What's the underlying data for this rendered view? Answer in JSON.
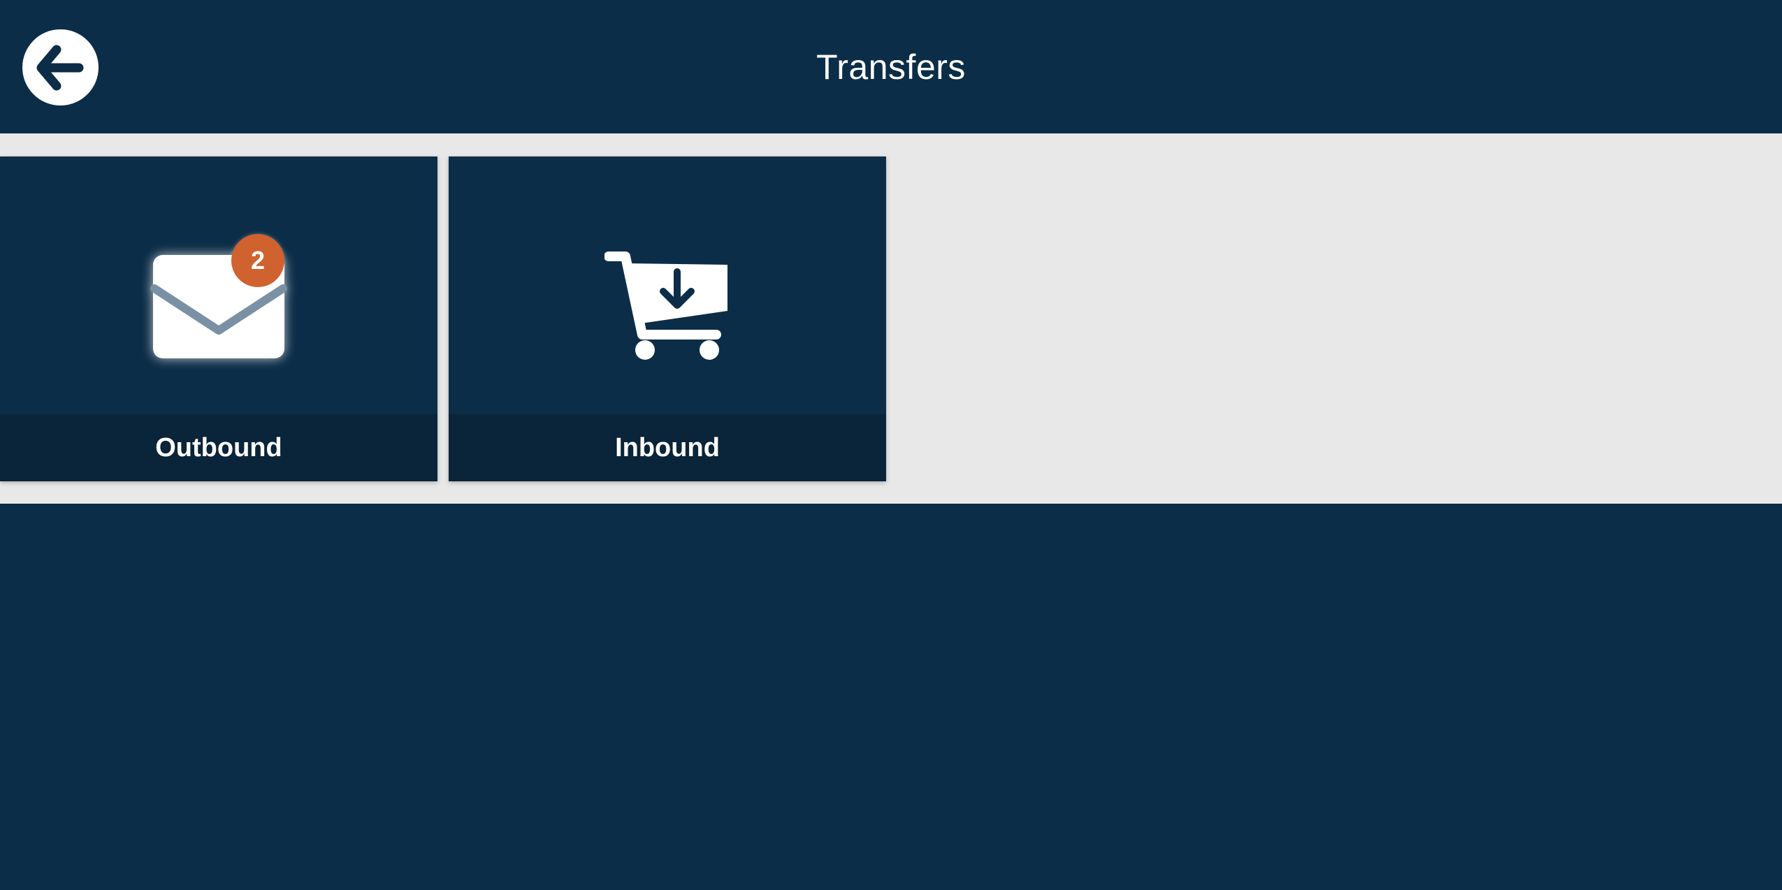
{
  "header": {
    "title": "Transfers",
    "back_icon": "arrow-left-icon"
  },
  "tiles": [
    {
      "label": "Outbound",
      "icon": "envelope-icon",
      "badge_count": "2",
      "badge_color": "#d0622f"
    },
    {
      "label": "Inbound",
      "icon": "cart-download-icon"
    }
  ],
  "colors": {
    "primary": "#0c2d48",
    "tile_footer": "#0a2439",
    "strip_background": "#e8e8e8"
  }
}
